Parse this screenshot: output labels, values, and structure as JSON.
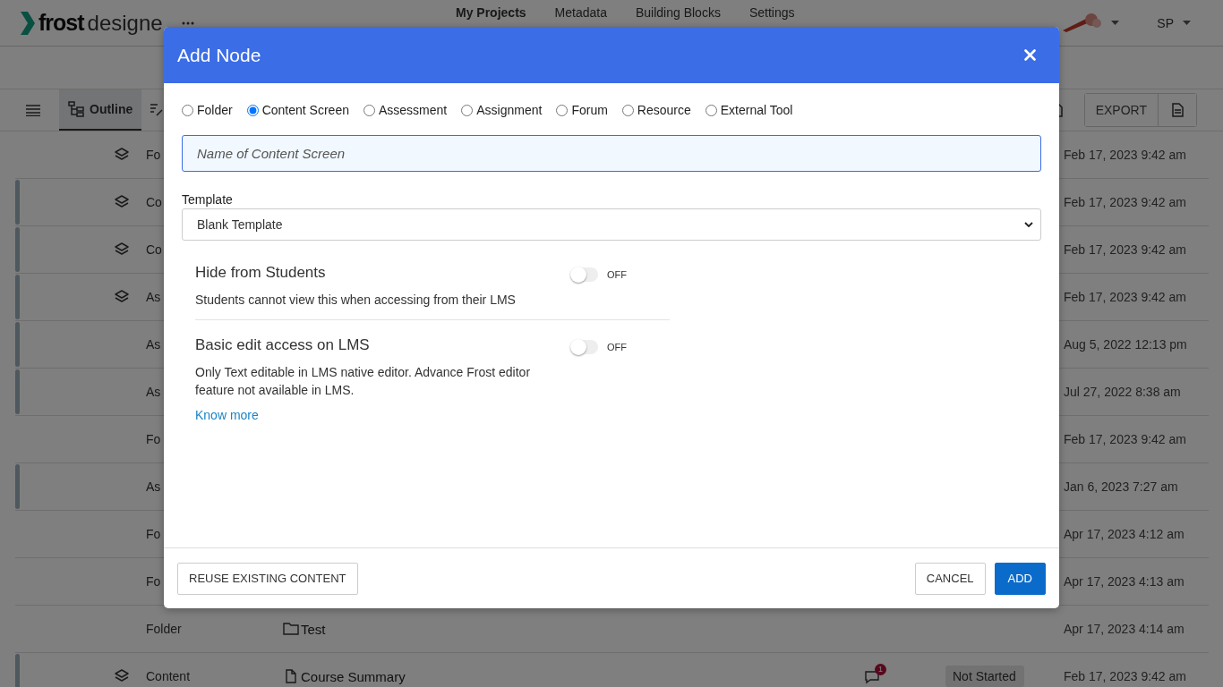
{
  "app_bar": {
    "logo_bold": "frost",
    "logo_light": "designe",
    "nav": [
      {
        "label": "My Projects",
        "selected": true
      },
      {
        "label": "Metadata",
        "selected": false
      },
      {
        "label": "Building Blocks",
        "selected": false
      },
      {
        "label": "Settings",
        "selected": false
      }
    ],
    "user": "SP"
  },
  "toolbar": {
    "tabs": [
      {
        "label": "Outline",
        "selected": true
      }
    ],
    "export": "EXPORT"
  },
  "rows": [
    {
      "flagged": false,
      "layers": true,
      "type": "Fo",
      "date": "Feb 17, 2023 9:42 am"
    },
    {
      "flagged": true,
      "layers": true,
      "type": "Co",
      "date": "Feb 17, 2023 9:42 am"
    },
    {
      "flagged": true,
      "layers": true,
      "type": "Co",
      "date": "Feb 17, 2023 9:42 am"
    },
    {
      "flagged": true,
      "layers": true,
      "type": "As",
      "date": "Feb 17, 2023 9:42 am"
    },
    {
      "flagged": true,
      "layers": false,
      "type": "As",
      "date": "Aug 5, 2022 12:13 pm"
    },
    {
      "flagged": true,
      "layers": false,
      "type": "As",
      "date": "Jul 27, 2022 8:38 am"
    },
    {
      "flagged": false,
      "layers": false,
      "type": "Fo",
      "date": "Feb 17, 2023 9:42 am"
    },
    {
      "flagged": true,
      "layers": false,
      "type": "As",
      "date": "Jan 6, 2023 7:27 am"
    },
    {
      "flagged": false,
      "layers": false,
      "type": "Fo",
      "date": "Apr 17, 2023 4:12 am"
    },
    {
      "flagged": false,
      "layers": false,
      "type": "Fo",
      "date": "Apr 17, 2023 4:13 am"
    },
    {
      "flagged": false,
      "layers": false,
      "type": "Folder",
      "kind": "folder",
      "name": "Test",
      "date": "Apr 17, 2023 4:14 am"
    },
    {
      "flagged": true,
      "layers": true,
      "type": "Content",
      "kind": "file",
      "name": "Course Summary",
      "comments": "1",
      "status": "Not Started",
      "date": "Feb 17, 2023 9:42 am"
    }
  ],
  "dialog": {
    "title": "Add Node",
    "node_types": [
      {
        "label": "Folder",
        "selected": false
      },
      {
        "label": "Content Screen",
        "selected": true
      },
      {
        "label": "Assessment",
        "selected": false
      },
      {
        "label": "Assignment",
        "selected": false
      },
      {
        "label": "Forum",
        "selected": false
      },
      {
        "label": "Resource",
        "selected": false
      },
      {
        "label": "External Tool",
        "selected": false
      }
    ],
    "name_field": {
      "placeholder": "Name of Content Screen"
    },
    "template": {
      "label": "Template",
      "value": "Blank Template"
    },
    "settings": [
      {
        "title": "Hide from Students",
        "description": "Students cannot view this when accessing from their LMS",
        "on": false,
        "state": "OFF"
      },
      {
        "title": "Basic edit access on LMS",
        "description": "Only Text editable in LMS native editor. Advance Frost editor feature not available in LMS.",
        "on": false,
        "state": "OFF",
        "link": "Know more"
      }
    ],
    "buttons": {
      "reuse": "REUSE EXISTING CONTENT",
      "cancel": "CANCEL",
      "add": "ADD"
    }
  }
}
